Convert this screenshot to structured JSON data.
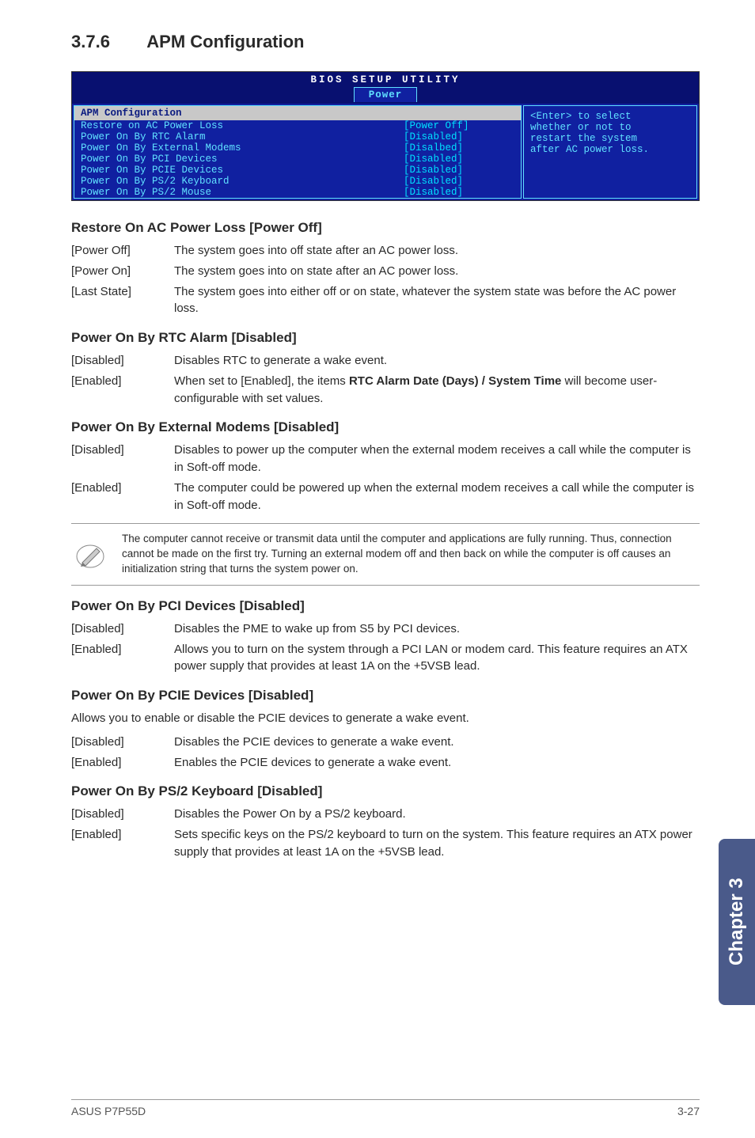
{
  "section": {
    "number": "3.7.6",
    "title": "APM Configuration"
  },
  "bios": {
    "utility_title": "BIOS SETUP UTILITY",
    "active_tab": "Power",
    "panel_heading": "APM Configuration",
    "rows": [
      {
        "key": "Restore on AC Power Loss",
        "val": "[Power Off]"
      },
      {
        "key": "Power On By RTC Alarm",
        "val": "[Disabled]"
      },
      {
        "key": "Power On By External Modems",
        "val": "[Disalbed]"
      },
      {
        "key": "Power On By PCI Devices",
        "val": "[Disabled]"
      },
      {
        "key": "Power On By PCIE Devices",
        "val": "[Disabled]"
      },
      {
        "key": "Power On By PS/2 Keyboard",
        "val": "[Disabled]"
      },
      {
        "key": "Power On By PS/2 Mouse",
        "val": "[Disabled]"
      }
    ],
    "help_line1": "<Enter> to select",
    "help_line2": "whether or not to",
    "help_line3": "restart the system",
    "help_line4": "after AC power loss."
  },
  "settings": [
    {
      "heading": "Restore On AC Power Loss [Power Off]",
      "options": [
        {
          "label": "[Power Off]",
          "desc": "The system goes into off state after an AC power loss."
        },
        {
          "label": "[Power On]",
          "desc": "The system goes into on state after an AC power loss."
        },
        {
          "label": "[Last State]",
          "desc": "The system goes into either off or on state, whatever the system state was before the AC power loss."
        }
      ]
    },
    {
      "heading": "Power On By RTC Alarm [Disabled]",
      "options": [
        {
          "label": "[Disabled]",
          "desc": "Disables RTC to generate a wake event."
        },
        {
          "label": "[Enabled]",
          "desc_prefix": "When set to [Enabled], the items ",
          "desc_bold": "RTC Alarm Date (Days) / System Time",
          "desc_suffix": " will become user-configurable with set values."
        }
      ]
    },
    {
      "heading": "Power On By External Modems [Disabled]",
      "options": [
        {
          "label": "[Disabled]",
          "desc": "Disables to power up the computer when the external modem receives a call while the computer is in Soft-off mode."
        },
        {
          "label": "[Enabled]",
          "desc": "The computer could be powered up when the external modem receives a call while the computer is in Soft-off mode."
        }
      ]
    }
  ],
  "note": {
    "icon_label": "note-pencil-icon",
    "text": "The computer cannot receive or transmit data until the computer and applications are fully running. Thus, connection cannot be made on the first try. Turning an external modem off and then back on while the computer is off causes an initialization string that turns the system power on."
  },
  "settings2": [
    {
      "heading": "Power On By PCI Devices [Disabled]",
      "options": [
        {
          "label": "[Disabled]",
          "desc": "Disables the PME to wake up from S5 by PCI devices."
        },
        {
          "label": "[Enabled]",
          "desc": "Allows you to turn on the system through a PCI LAN or modem card. This feature requires an ATX power supply that provides at least 1A on the +5VSB lead."
        }
      ]
    },
    {
      "heading": "Power On By PCIE Devices [Disabled]",
      "intro": "Allows you to enable or disable the PCIE devices to generate a wake event.",
      "options": [
        {
          "label": "[Disabled]",
          "desc": "Disables the PCIE devices to generate a wake event."
        },
        {
          "label": "[Enabled]",
          "desc": "Enables the PCIE devices to generate a wake event."
        }
      ]
    },
    {
      "heading": "Power On By PS/2 Keyboard [Disabled]",
      "options": [
        {
          "label": "[Disabled]",
          "desc": "Disables the Power On by a PS/2 keyboard."
        },
        {
          "label": "[Enabled]",
          "desc": "Sets specific keys on the PS/2 keyboard to turn on the system. This feature requires an ATX power supply that provides at least 1A on the +5VSB lead."
        }
      ]
    }
  ],
  "sidebar": {
    "label": "Chapter 3"
  },
  "footer": {
    "left": "ASUS P7P55D",
    "right": "3-27"
  }
}
